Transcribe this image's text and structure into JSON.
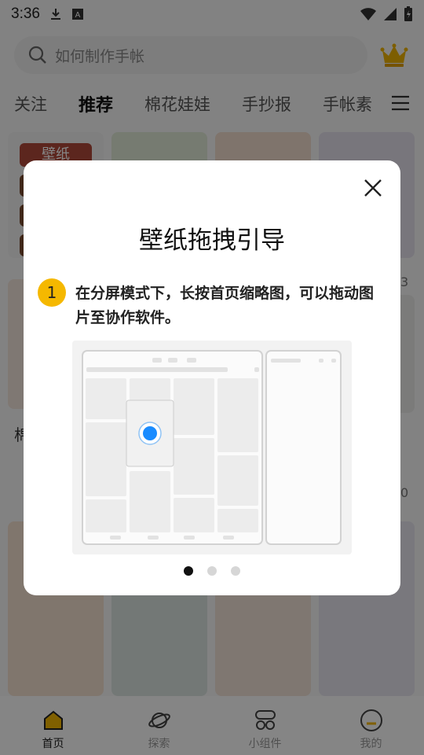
{
  "status_bar": {
    "time": "3:36"
  },
  "search": {
    "placeholder": "如何制作手帐"
  },
  "tabs": [
    {
      "label": "关注"
    },
    {
      "label": "推荐",
      "active": true
    },
    {
      "label": "棉花娃娃"
    },
    {
      "label": "手抄报"
    },
    {
      "label": "手帐素"
    }
  ],
  "feed": {
    "wallpaper_tag": "壁纸",
    "partial_left_char": "棉",
    "partial_right_number_1": "3",
    "partial_right_number_2": "0"
  },
  "bottom_nav": [
    {
      "label": "首页",
      "icon": "home-icon",
      "active": true
    },
    {
      "label": "探索",
      "icon": "planet-icon"
    },
    {
      "label": "小组件",
      "icon": "widget-icon"
    },
    {
      "label": "我的",
      "icon": "profile-icon"
    }
  ],
  "dialog": {
    "title": "壁纸拖拽引导",
    "step_number": "1",
    "step_text": "在分屏模式下，长按首页缩略图，可以拖动图片至协作软件。",
    "pager": {
      "count": 3,
      "active_index": 0
    }
  },
  "colors": {
    "accent": "#f5b800",
    "tab_underline": "#e6a800",
    "drag_dot": "#1a8cff",
    "overlay": "rgba(0,0,0,0.48)"
  }
}
